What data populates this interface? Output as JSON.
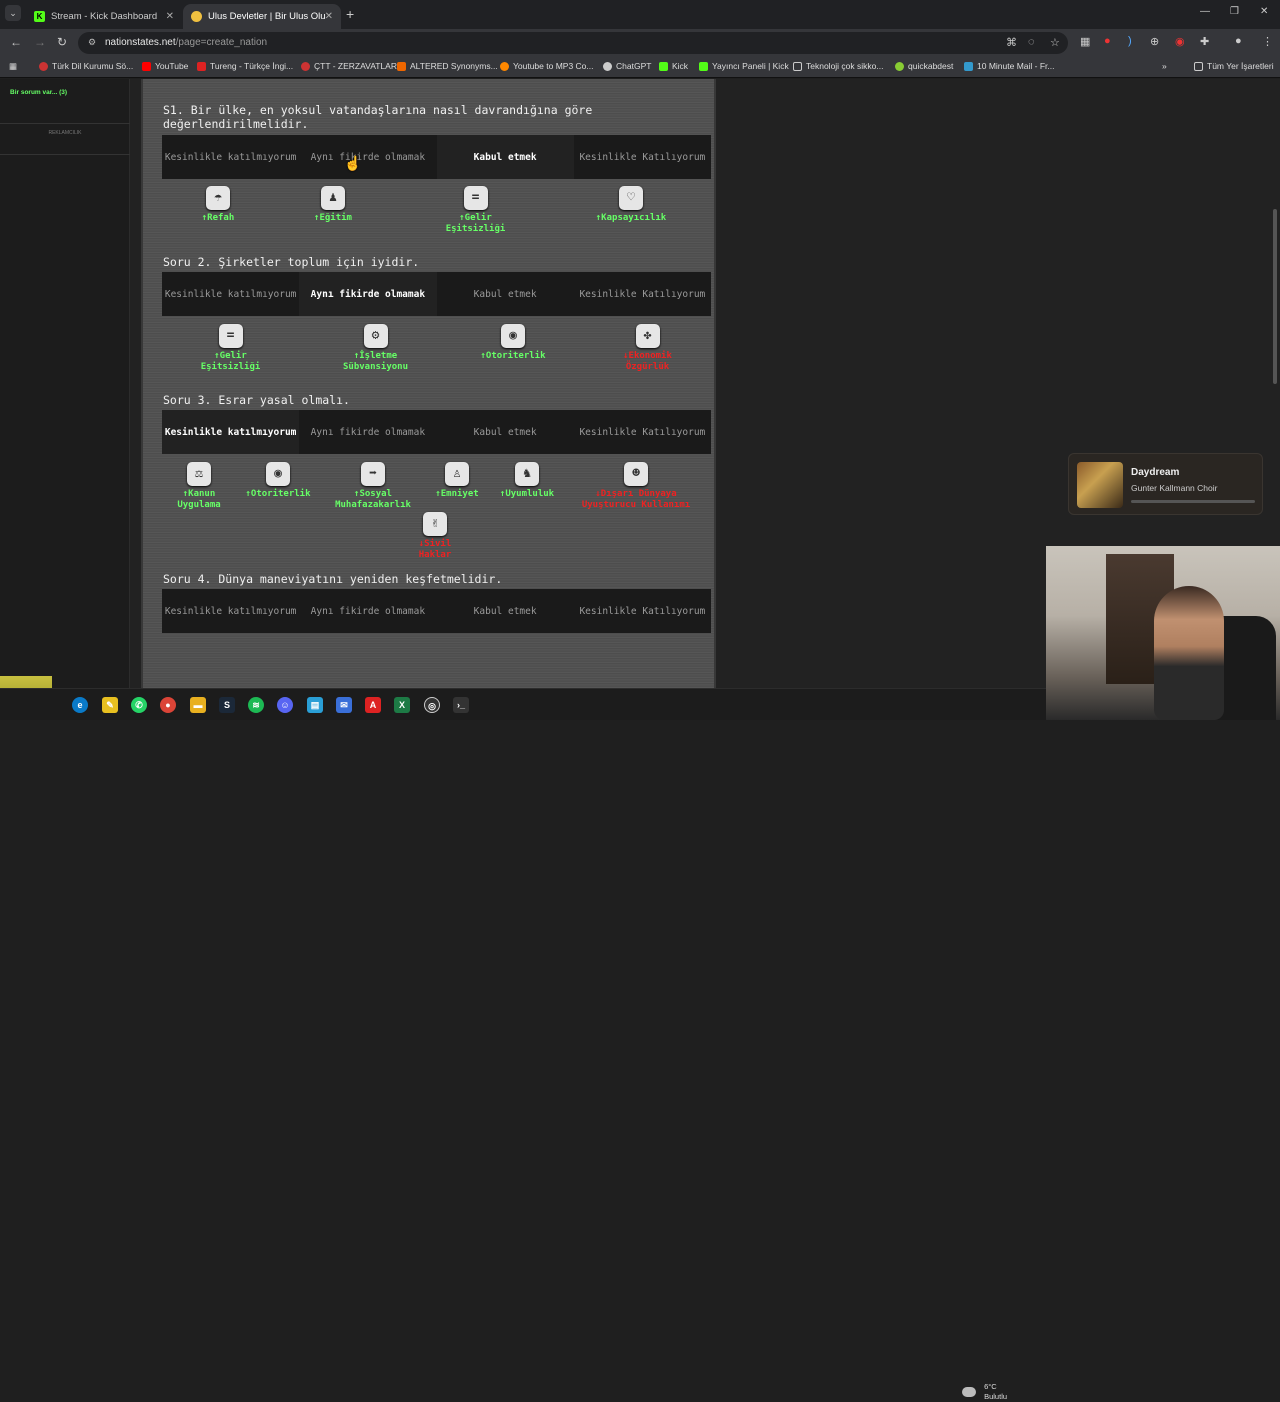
{
  "browser": {
    "tabs": [
      {
        "title": "Stream - Kick Dashboard",
        "icon": "kick-icon",
        "active": false
      },
      {
        "title": "Ulus Devletler | Bir Ulus Oluştur",
        "icon": "globe-icon",
        "active": true
      }
    ],
    "url_host": "nationstates.net",
    "url_path": "/page=create_nation",
    "bookmarks": [
      "Türk Dil Kurumu Sö...",
      "YouTube",
      "Tureng - Türkçe İngi...",
      "ÇTT - ZERZAVATLAR",
      "ALTERED Synonyms...",
      "Youtube to MP3 Co...",
      "ChatGPT",
      "Kick",
      "Yayıncı Paneli | Kick",
      "Teknoloji çok sikko...",
      "quickabdest",
      "10 Minute Mail - Fr..."
    ],
    "all_bookmarks": "Tüm Yer İşaretleri"
  },
  "sidebar": {
    "issues": "Bir sorum var... (3)",
    "ad": "REKLAMCILIK"
  },
  "options": [
    "Kesinlikle katılmıyorum",
    "Aynı fikirde olmamak",
    "Kabul etmek",
    "Kesinlikle Katılıyorum"
  ],
  "questions": [
    {
      "text": "S1. Bir ülke, en yoksul vatandaşlarına nasıl davrandığına göre değerlendirilmelidir.",
      "selected": 2,
      "policies": [
        {
          "label": "↑Refah",
          "icon": "umbrella-icon",
          "dir": "up"
        },
        {
          "label": "↑Eğitim",
          "icon": "teacher-icon",
          "dir": "up"
        },
        {
          "label": "↑Gelir Eşitsizliği",
          "icon": "equals-icon",
          "dir": "up"
        },
        {
          "label": "↑Kapsayıcılık",
          "icon": "hearts-icon",
          "dir": "up"
        }
      ]
    },
    {
      "text": "Soru 2. Şirketler toplum için iyidir.",
      "selected": 1,
      "policies": [
        {
          "label": "↑Gelir Eşitsizliği",
          "icon": "equals-icon",
          "dir": "up"
        },
        {
          "label": "↑İşletme Sübvansiyonu",
          "icon": "gear-icon",
          "dir": "up"
        },
        {
          "label": "↑Otoriterlik",
          "icon": "eye-icon",
          "dir": "up"
        },
        {
          "label": "↓Ekonomik Özgürlük",
          "icon": "paw-icon",
          "dir": "down"
        }
      ]
    },
    {
      "text": "Soru 3. Esrar yasal olmalı.",
      "selected": 0,
      "policies": [
        {
          "label": "↑Kanun Uygulama",
          "icon": "scales-icon",
          "dir": "up"
        },
        {
          "label": "↑Otoriterlik",
          "icon": "eye-icon",
          "dir": "up"
        },
        {
          "label": "↑Sosyal Muhafazakarlık",
          "icon": "keep-right-icon",
          "dir": "up"
        },
        {
          "label": "↑Emniyet",
          "icon": "person-icon",
          "dir": "up"
        },
        {
          "label": "↑Uyumluluk",
          "icon": "rabbit-icon",
          "dir": "up"
        },
        {
          "label": "↓Dışarı Dünyaya Uyuşturucu Kullanımı",
          "icon": "alien-icon",
          "dir": "down"
        },
        {
          "label": "↓Sivil Haklar",
          "icon": "peace-hand-icon",
          "dir": "down"
        }
      ]
    },
    {
      "text": "Soru 4. Dünya maneviyatını yeniden keşfetmelidir.",
      "selected": -1,
      "policies": []
    }
  ],
  "music": {
    "title": "Daydream",
    "artist": "Gunter Kallmann Choir"
  },
  "weather": {
    "temp": "6°C",
    "desc": "Bulutlu"
  },
  "colors": {
    "up": "#66ff66",
    "down": "#ee2222",
    "kick": "#53fc18"
  }
}
